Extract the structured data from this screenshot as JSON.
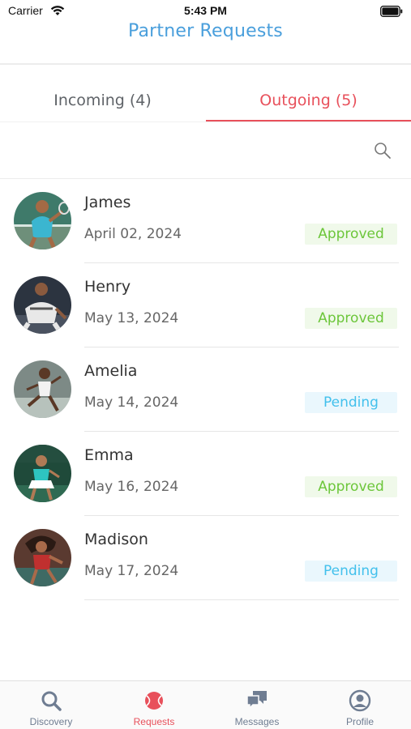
{
  "status_bar": {
    "carrier": "Carrier",
    "time": "5:43 PM"
  },
  "header": {
    "title": "Partner Requests"
  },
  "tabs": [
    {
      "label": "Incoming (4)",
      "active": false
    },
    {
      "label": "Outgoing (5)",
      "active": true
    }
  ],
  "accent_color": "#e8505b",
  "title_color": "#4a9fdc",
  "requests": [
    {
      "name": "James",
      "date": "April 02, 2024",
      "status": "Approved"
    },
    {
      "name": "Henry",
      "date": "May 13, 2024",
      "status": "Approved"
    },
    {
      "name": "Amelia",
      "date": "May 14, 2024",
      "status": "Pending"
    },
    {
      "name": "Emma",
      "date": "May 16, 2024",
      "status": "Approved"
    },
    {
      "name": "Madison",
      "date": "May 17, 2024",
      "status": "Pending"
    }
  ],
  "status_colors": {
    "Approved": "#6cc63a",
    "Pending": "#42c0ec"
  },
  "tabbar": [
    {
      "label": "Discovery",
      "icon": "search-icon",
      "active": false
    },
    {
      "label": "Requests",
      "icon": "tennis-ball-icon",
      "active": true
    },
    {
      "label": "Messages",
      "icon": "chat-bubbles-icon",
      "active": false
    },
    {
      "label": "Profile",
      "icon": "user-circle-icon",
      "active": false
    }
  ]
}
